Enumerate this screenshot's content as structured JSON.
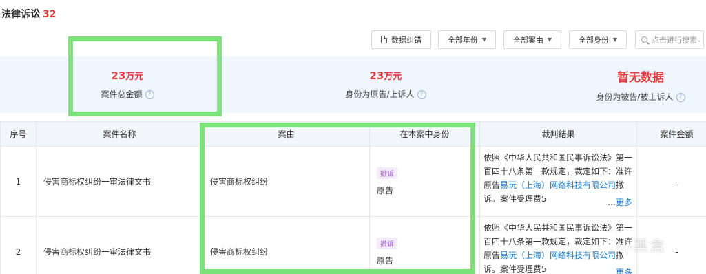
{
  "header": {
    "title": "法律诉讼",
    "count": "32"
  },
  "toolbar": {
    "correction_label": "数据纠错",
    "year_filter": "全部年份",
    "cause_filter": "全部案由",
    "role_filter": "全部身份",
    "search_placeholder": "点击进行搜索"
  },
  "summary": [
    {
      "value": "23",
      "unit": "万元",
      "label": "案件总金额"
    },
    {
      "value": "23",
      "unit": "万元",
      "label": "身份为原告/上诉人"
    },
    {
      "value": "暂无数据",
      "unit": "",
      "label": "身份为被告/被上诉人"
    }
  ],
  "table": {
    "columns": [
      "序号",
      "案件名称",
      "案由",
      "在本案中身份",
      "裁判结果",
      "案件金额"
    ],
    "rows": [
      {
        "index": "1",
        "name": "侵害商标权纠纷一审法律文书",
        "cause": "侵害商标权纠纷",
        "badge": "撤诉",
        "role": "原告",
        "verdict_pre": "依照《中华人民共和国民事诉讼法》第一百四十八条第一款规定，裁定如下：准许原告",
        "verdict_link": "易玩（上海）网络科技有限公司",
        "verdict_post": "撤诉。案件受理费5",
        "more": "更多",
        "amount": "-"
      },
      {
        "index": "2",
        "name": "侵害商标权纠纷一审法律文书",
        "cause": "侵害商标权纠纷",
        "badge": "撤诉",
        "role": "原告",
        "verdict_pre": "依照《中华人民共和国民事诉讼法》第一百四十八条第一款规定，裁定如下：准许原告",
        "verdict_link": "易玩（上海）网络科技有限公司",
        "verdict_post": "撤诉。案件受理费5",
        "more": "更多",
        "amount": "-"
      }
    ]
  },
  "watermark": "小黑盒"
}
